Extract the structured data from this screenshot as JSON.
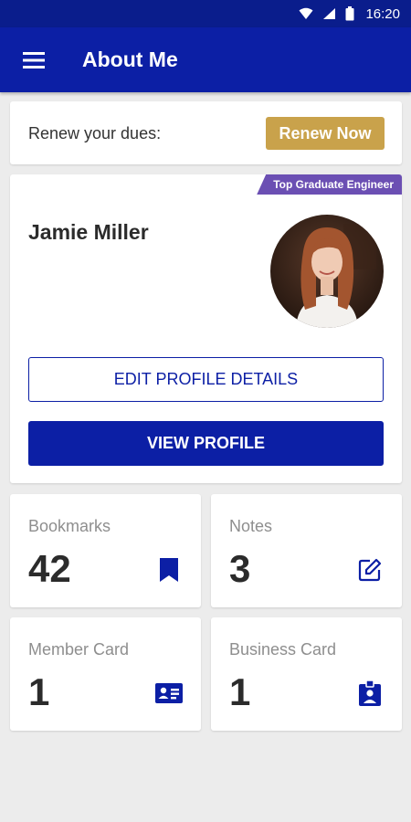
{
  "status_bar": {
    "time": "16:20",
    "icons": [
      "wifi-icon",
      "signal-icon",
      "battery-icon"
    ]
  },
  "app_bar": {
    "title": "About Me",
    "menu_icon": "hamburger-menu-icon"
  },
  "renew": {
    "text": "Renew your dues:",
    "button_label": "Renew Now"
  },
  "profile": {
    "badge": "Top Graduate Engineer",
    "name": "Jamie Miller",
    "edit_label": "EDIT PROFILE DETAILS",
    "view_label": "VIEW PROFILE"
  },
  "tiles": [
    {
      "label": "Bookmarks",
      "count": "42",
      "icon": "bookmark-icon"
    },
    {
      "label": "Notes",
      "count": "3",
      "icon": "edit-note-icon"
    },
    {
      "label": "Member Card",
      "count": "1",
      "icon": "id-card-icon"
    },
    {
      "label": "Business Card",
      "count": "1",
      "icon": "contact-badge-icon"
    }
  ],
  "colors": {
    "primary": "#0c1fa5",
    "status_bar": "#0a1d8c",
    "accent_gold": "#c9a24b",
    "badge_purple": "#6b4fb3",
    "background": "#ececec"
  }
}
